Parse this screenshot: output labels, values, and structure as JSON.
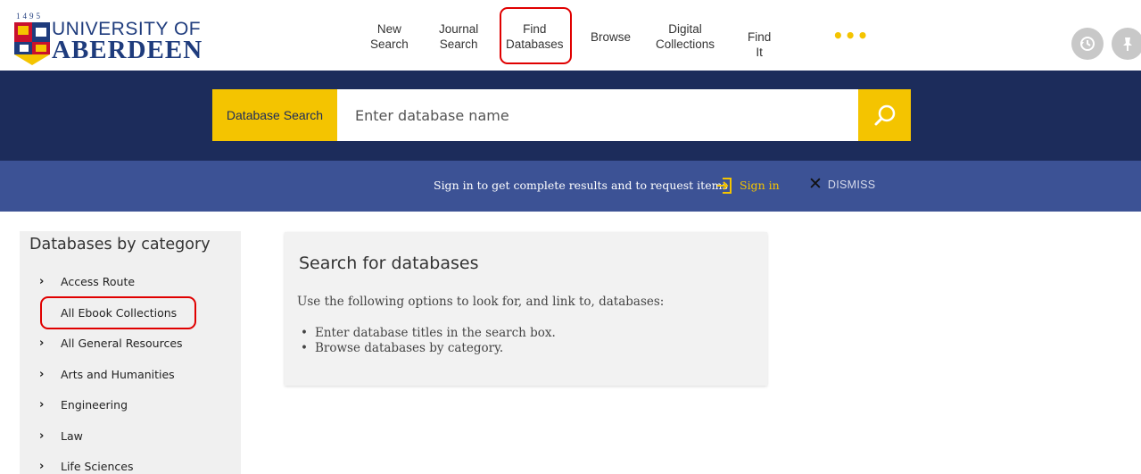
{
  "logo": {
    "year": "1495",
    "line1": "UNIVERSITY OF",
    "line2": "ABERDEEN"
  },
  "nav": {
    "items": [
      {
        "label": "New\nSearch"
      },
      {
        "label": "Journal\nSearch"
      },
      {
        "label": "Find\nDatabases"
      },
      {
        "label": "Browse"
      },
      {
        "label": "Digital\nCollections"
      },
      {
        "label": "Find It"
      }
    ],
    "more": "•••"
  },
  "header_icons": [
    "history-icon",
    "pin-icon"
  ],
  "search": {
    "label": "Database Search",
    "placeholder": "Enter database name",
    "button_icon": "search-icon"
  },
  "signin_bar": {
    "message": "Sign in to get complete results and to request items",
    "signin_label": "Sign in",
    "dismiss_label": "DISMISS"
  },
  "sidebar": {
    "title": "Databases by category",
    "items": [
      {
        "label": "Access Route",
        "expandable": true
      },
      {
        "label": "All Ebook Collections",
        "expandable": false
      },
      {
        "label": "All General Resources",
        "expandable": true
      },
      {
        "label": "Arts and Humanities",
        "expandable": true
      },
      {
        "label": "Engineering",
        "expandable": true
      },
      {
        "label": "Law",
        "expandable": true
      },
      {
        "label": "Life Sciences",
        "expandable": true
      }
    ]
  },
  "panel": {
    "title": "Search for databases",
    "intro": "Use the following options to look for, and link to, databases:",
    "bullets": [
      "Enter database titles in the search box.",
      "Browse databases by category."
    ]
  },
  "colors": {
    "navy": "#1c2c5b",
    "signin_blue": "#3c5295",
    "accent_yellow": "#f4c400",
    "highlight_red": "#e00000"
  }
}
